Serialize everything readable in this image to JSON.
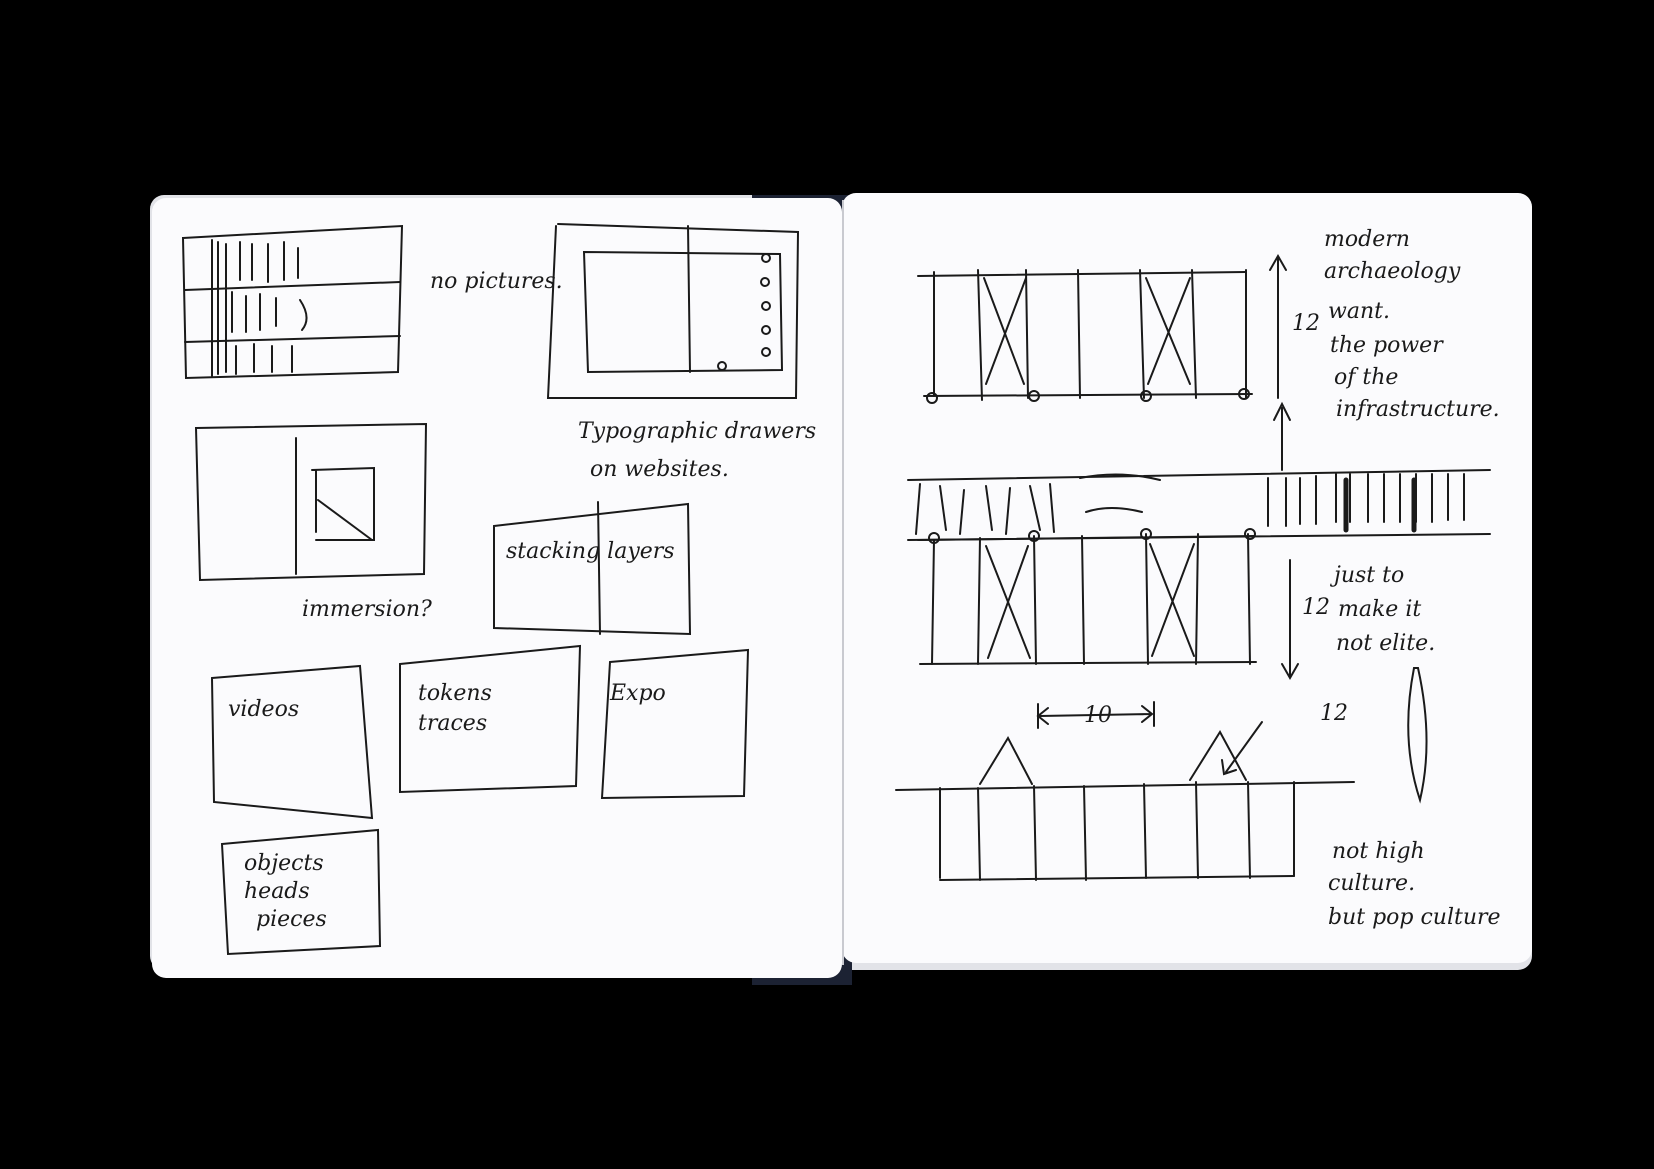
{
  "colors": {
    "background": "#000000",
    "paper": "#fbfbfd",
    "paper_edge": "#e2e3e8",
    "spine": "#1c2233",
    "ink": "#1a1a1a",
    "ink_light": "#6b6b6b"
  },
  "left_page": {
    "notes": [
      {
        "id": "note-no-pictures",
        "text": "no pictures."
      },
      {
        "id": "note-typographic-drawers",
        "text": "Typographic drawers"
      },
      {
        "id": "note-on-websites",
        "text": "on websites."
      },
      {
        "id": "note-immersion",
        "text": "immersion?"
      },
      {
        "id": "note-stacking-layers",
        "text": "stacking layers"
      },
      {
        "id": "note-videos",
        "text": "videos"
      },
      {
        "id": "note-tokens-traces",
        "text": "tokens traces"
      },
      {
        "id": "note-expo",
        "text": "Expo"
      },
      {
        "id": "note-objects-heads-pieces",
        "text": "objects heads pieces"
      }
    ]
  },
  "right_page": {
    "notes": [
      {
        "id": "note-modern-archaeology",
        "text": "modern archaeology"
      },
      {
        "id": "note-12-top",
        "text": "12"
      },
      {
        "id": "note-want-the-power",
        "text": "want. the power"
      },
      {
        "id": "note-of-the-infrastructure",
        "text": "of the infrastructure."
      },
      {
        "id": "note-just-to-make-it",
        "text": "just to make it"
      },
      {
        "id": "note-not-elite",
        "text": "not elite."
      },
      {
        "id": "note-12-left",
        "text": "12"
      },
      {
        "id": "note-10",
        "text": "10"
      },
      {
        "id": "note-12-diag",
        "text": "12"
      },
      {
        "id": "note-not-high-culture",
        "text": "not high culture."
      },
      {
        "id": "note-but-pop-culture",
        "text": "but pop culture"
      }
    ]
  }
}
